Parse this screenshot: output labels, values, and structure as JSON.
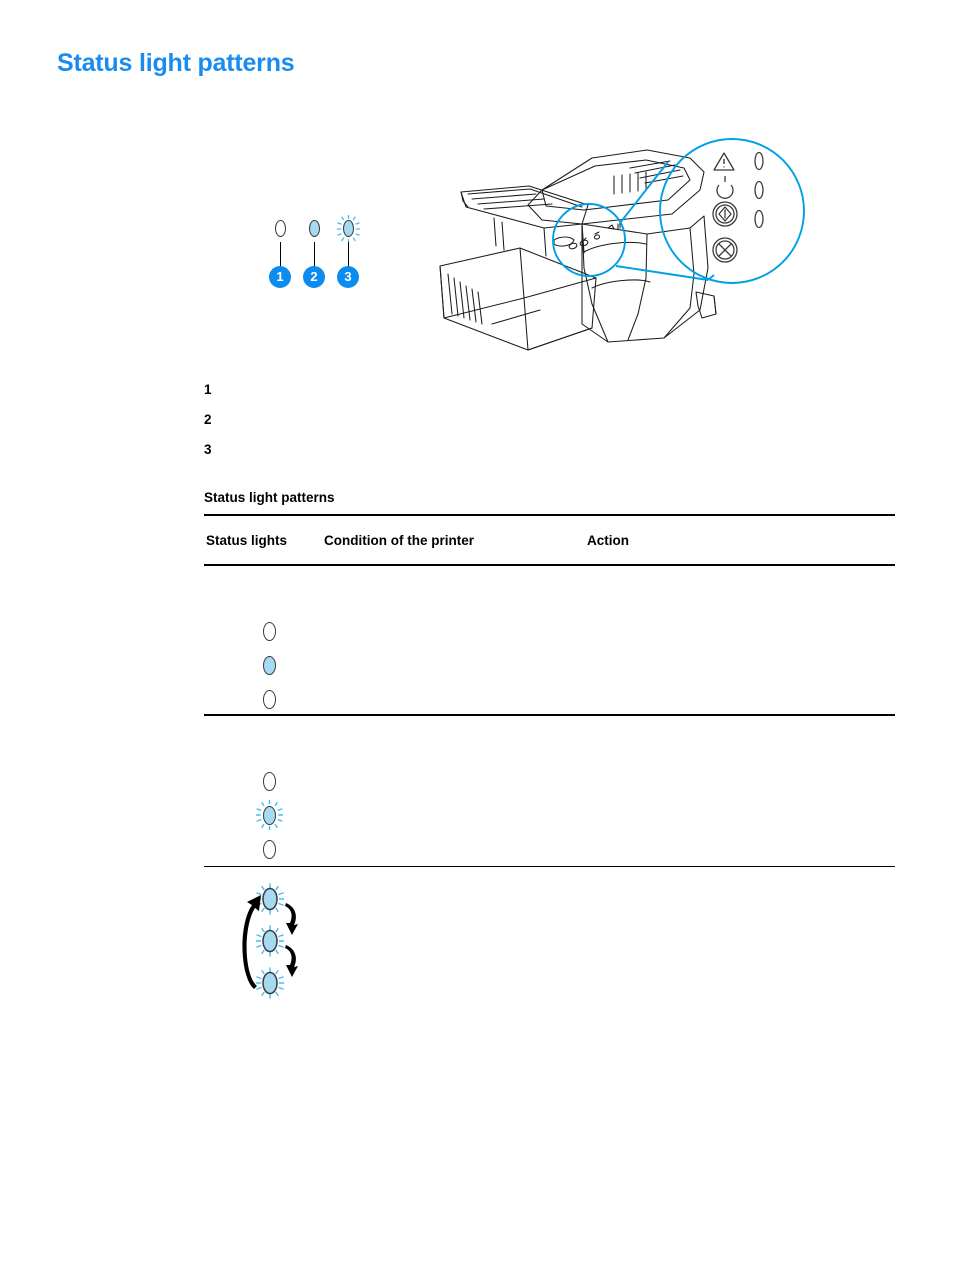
{
  "page": {
    "title": "Status light patterns",
    "background_color": "#ffffff",
    "title_color": "#1a8cf0"
  },
  "colors": {
    "accent_blue": "#0d8cf0",
    "callout_blue": "#00a0e4",
    "lamp_on_fill": "#a6d9f2",
    "lamp_outline": "#3b3b3b",
    "line_art": "#1c1c1c",
    "rule": "#000000"
  },
  "legend": {
    "items": [
      {
        "number": "1",
        "state": "off",
        "icon": "light-off-icon",
        "label": ""
      },
      {
        "number": "2",
        "state": "on",
        "icon": "light-on-icon",
        "label": ""
      },
      {
        "number": "3",
        "state": "blinking",
        "icon": "light-blinking-icon",
        "label": ""
      }
    ]
  },
  "illustration": {
    "name": "printer-with-control-panel-callout",
    "callout": {
      "panel_icons": [
        {
          "name": "attention-triangle-icon",
          "has_led": true
        },
        {
          "name": "ready-circle-icon",
          "has_led": true
        },
        {
          "name": "go-button-icon",
          "has_led": true
        },
        {
          "name": "cancel-button-icon",
          "has_led": false
        }
      ]
    }
  },
  "caption_list": [
    {
      "number": "1",
      "text": ""
    },
    {
      "number": "2",
      "text": ""
    },
    {
      "number": "3",
      "text": ""
    }
  ],
  "table": {
    "caption": "Status light patterns",
    "columns": [
      "Status lights",
      "Condition of the printer",
      "Action"
    ],
    "rows": [
      {
        "lights": [
          "off",
          "on",
          "off"
        ],
        "pattern": "static",
        "condition": "",
        "action": ""
      },
      {
        "lights": [
          "off",
          "blinking",
          "off"
        ],
        "pattern": "static",
        "condition": "",
        "action": ""
      },
      {
        "lights": [
          "blinking",
          "blinking",
          "blinking"
        ],
        "pattern": "cycling",
        "condition": "",
        "action": ""
      }
    ]
  }
}
